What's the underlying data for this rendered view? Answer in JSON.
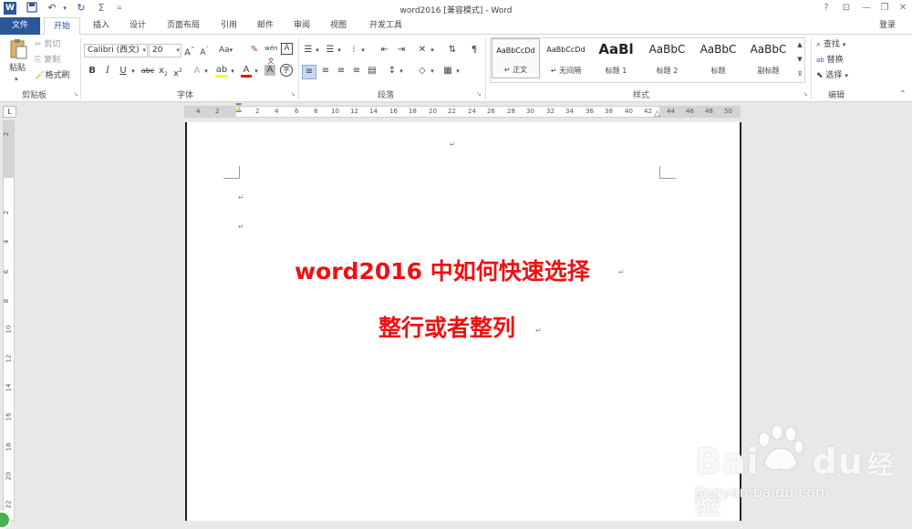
{
  "window": {
    "title": "word2016 [兼容模式] - Word",
    "signin": "登录",
    "help": "?",
    "minimize": "—",
    "restore": "❐",
    "close": "✕"
  },
  "quick_access": {
    "word_icon": "W",
    "save_icon": "save-icon",
    "undo_icon": "undo-icon",
    "redo_icon": "redo-icon",
    "sigma": "Σ",
    "customize": "="
  },
  "tabs": [
    "文件",
    "开始",
    "插入",
    "设计",
    "页面布局",
    "引用",
    "邮件",
    "审阅",
    "视图",
    "开发工具"
  ],
  "active_tab": "开始",
  "ribbon": {
    "clipboard": {
      "label": "剪贴板",
      "paste": "粘贴",
      "cut": "剪切",
      "copy": "复制",
      "format_painter": "格式刷"
    },
    "font": {
      "label": "字体",
      "font_name": "Calibri (西文)",
      "font_size": "20",
      "aa": "Aa"
    },
    "paragraph": {
      "label": "段落"
    },
    "styles": {
      "label": "样式",
      "items": [
        {
          "sample": "AaBbCcDd",
          "name": "↵ 正文"
        },
        {
          "sample": "AaBbCcDd",
          "name": "↵ 无间隔"
        },
        {
          "sample": "AaBl",
          "name": "标题 1"
        },
        {
          "sample": "AaBbC",
          "name": "标题 2"
        },
        {
          "sample": "AaBbC",
          "name": "标题"
        },
        {
          "sample": "AaBbC",
          "name": "副标题"
        }
      ]
    },
    "editing": {
      "label": "编辑",
      "find": "查找",
      "replace": "替换",
      "select": "选择"
    }
  },
  "ruler": {
    "h_numbers": [
      "4",
      "2",
      "2",
      "4",
      "6",
      "8",
      "10",
      "12",
      "14",
      "16",
      "18",
      "20",
      "22",
      "24",
      "26",
      "28",
      "30",
      "32",
      "34",
      "36",
      "38",
      "40",
      "42",
      "44",
      "46",
      "48",
      "50"
    ],
    "v_numbers": [
      "2",
      "2",
      "4",
      "6",
      "8",
      "10",
      "12",
      "14",
      "16",
      "18",
      "20",
      "22"
    ],
    "tab_selector": "L"
  },
  "document": {
    "para_mark": "↵",
    "heading_line1": "word2016 中如何快速选择",
    "heading_line2": "整行或者整列",
    "heading_color": "#ee1111"
  },
  "watermark": {
    "brand": "Bai",
    "du": "du",
    "cn": "经验",
    "url": "jingyan.baidu.com"
  }
}
